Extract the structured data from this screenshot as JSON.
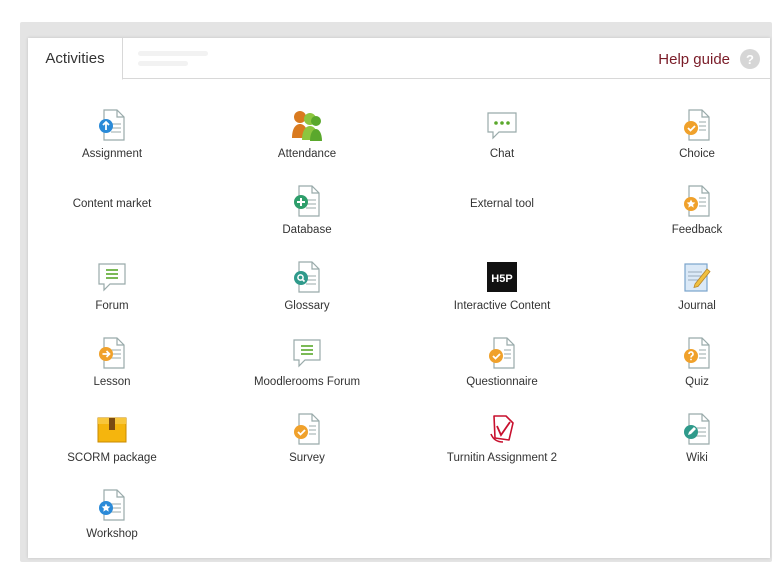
{
  "tabs": {
    "active": "Activities"
  },
  "help": {
    "label": "Help guide",
    "icon_text": "?"
  },
  "items": {
    "assignment": "Assignment",
    "attendance": "Attendance",
    "chat": "Chat",
    "choice": "Choice",
    "content_market": "Content market",
    "database": "Database",
    "external_tool": "External tool",
    "feedback": "Feedback",
    "forum": "Forum",
    "glossary": "Glossary",
    "interactive_content": "Interactive Content",
    "journal": "Journal",
    "lesson": "Lesson",
    "moodlerooms_forum": "Moodlerooms Forum",
    "questionnaire": "Questionnaire",
    "quiz": "Quiz",
    "scorm": "SCORM package",
    "survey": "Survey",
    "turnitin": "Turnitin Assignment 2",
    "wiki": "Wiki",
    "workshop": "Workshop"
  },
  "icons": {
    "h5p_text": "H5P"
  },
  "colors": {
    "blue": "#2a8ad8",
    "green": "#2e9e6b",
    "teal": "#2f9a8b",
    "orange": "#f0a12b",
    "help_red": "#7a1c28"
  }
}
